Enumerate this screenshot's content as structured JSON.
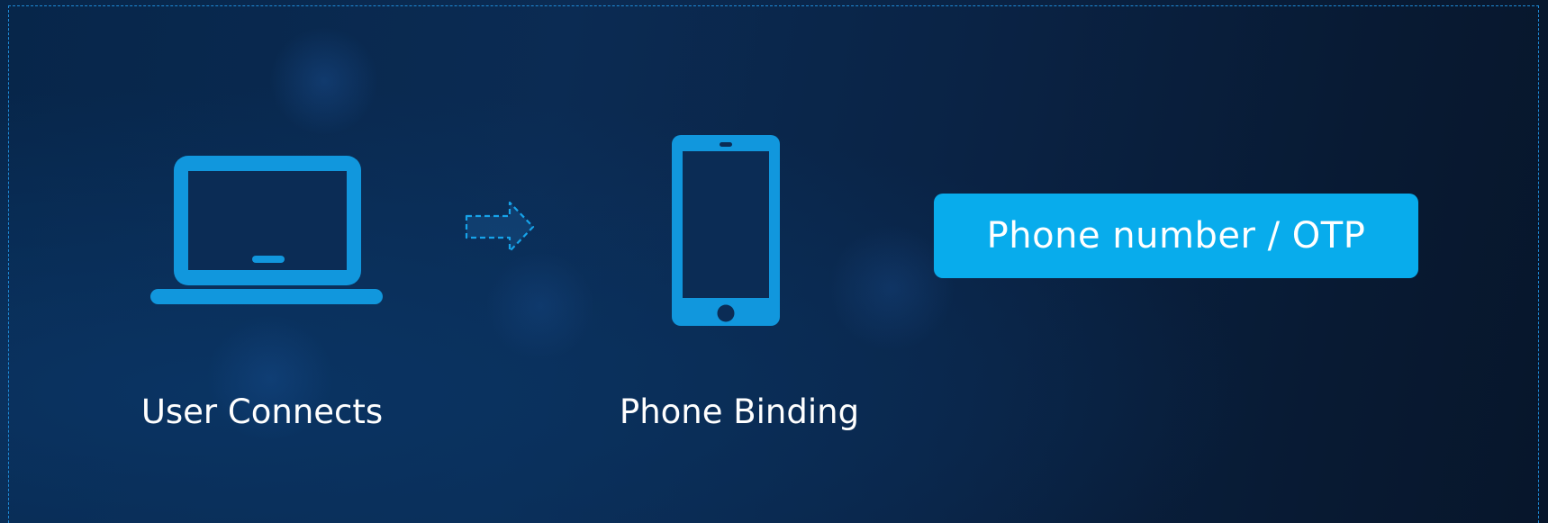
{
  "flow": {
    "step1_label": "User Connects",
    "step1_icon": "laptop-icon",
    "connector_icon": "dashed-right-arrow-icon",
    "step2_label": "Phone Binding",
    "step2_icon": "smartphone-icon",
    "step3_box_text": "Phone number / OTP"
  },
  "colors": {
    "icon_blue": "#1197dd",
    "box_fill": "#08acec",
    "frame_dashed": "#1e8ad6",
    "background_dark": "#0a2345",
    "text": "#ffffff"
  }
}
